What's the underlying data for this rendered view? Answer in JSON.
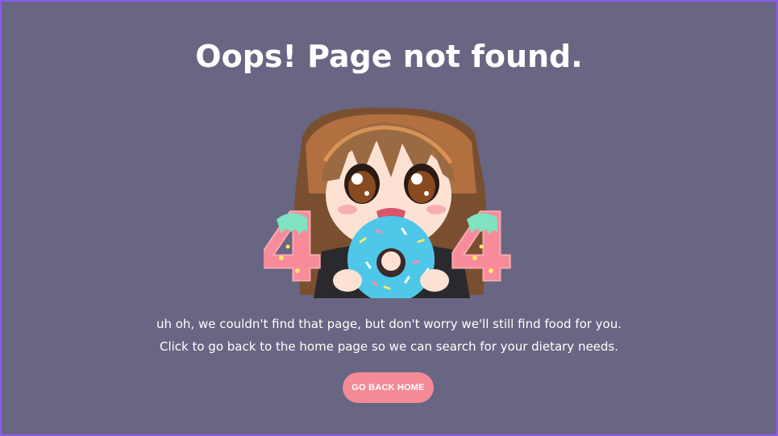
{
  "page": {
    "title": "Oops! Page not found.",
    "message_line1": "uh oh, we couldn't find that page, but don't worry we'll still find food for you.",
    "message_line2": "Click to go back to the home page so we can search for your dietary needs.",
    "home_button_label": "GO BACK HOME"
  },
  "illustration": {
    "left_digit": "4",
    "right_digit": "4",
    "icon": "girl-eating-donut-404-illustration"
  },
  "colors": {
    "background": "#686682",
    "border": "#8a5cf0",
    "button": "#f48a95",
    "text": "#ffffff",
    "donut": "#4fc7e8",
    "digit": "#f78b99",
    "digit_drip": "#7de3c0"
  }
}
